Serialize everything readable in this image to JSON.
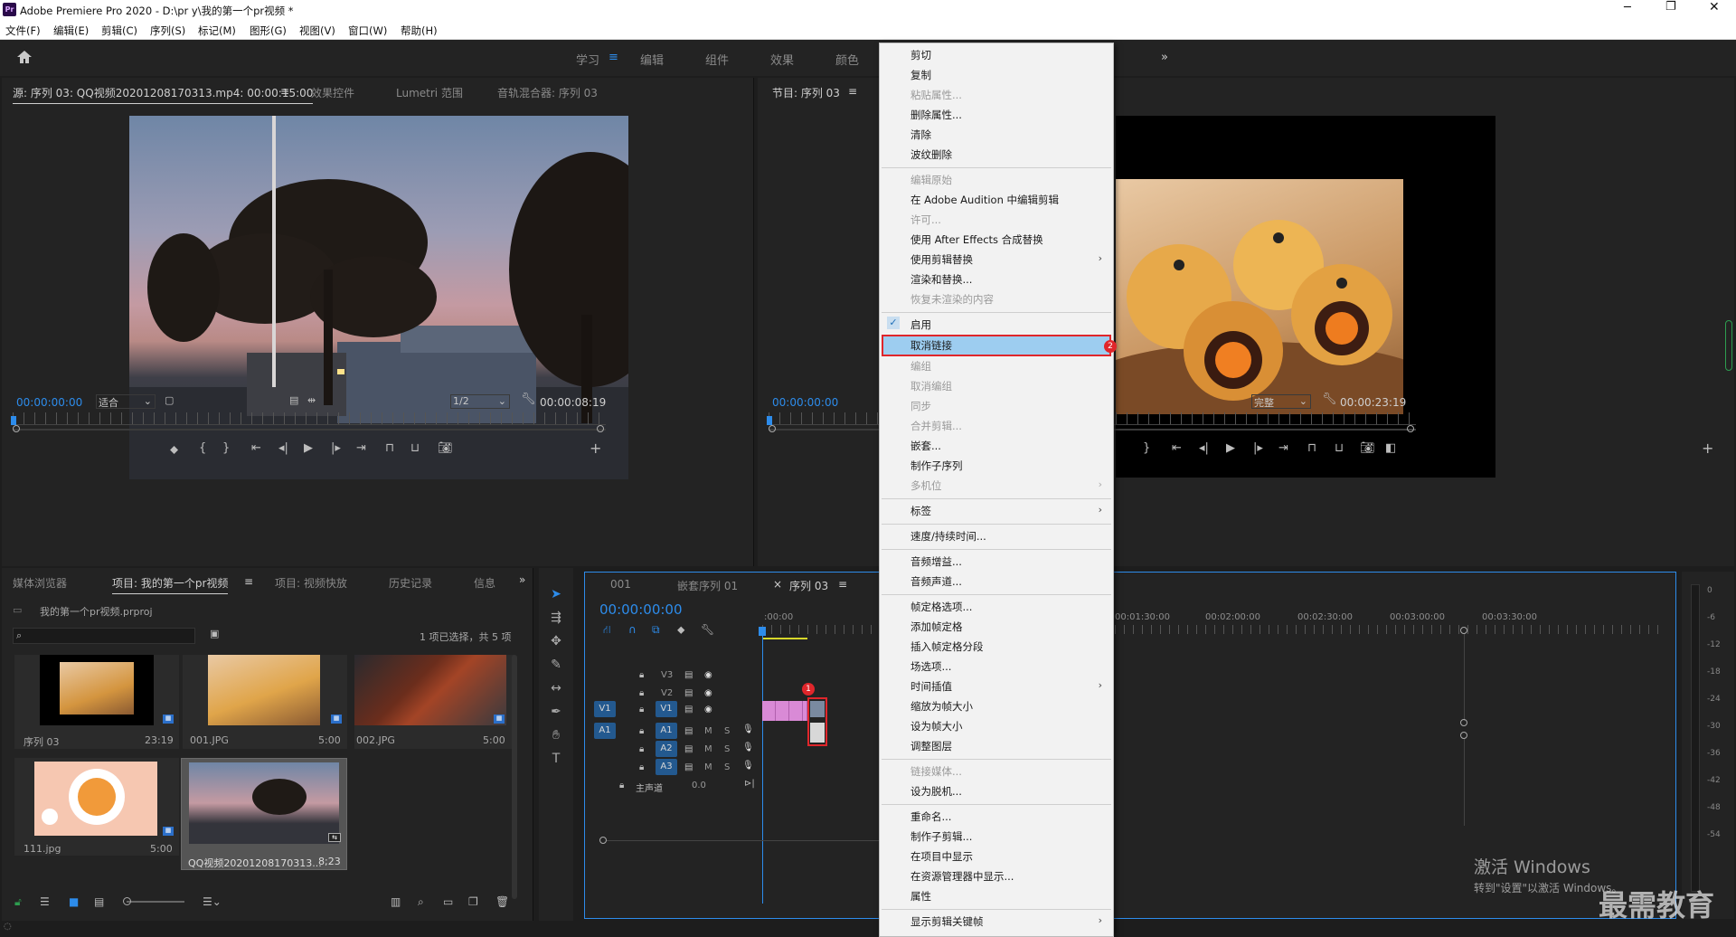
{
  "app": {
    "title": "Adobe Premiere Pro 2020 - D:\\pr y\\我的第一个pr视频 *",
    "logo": "Pr"
  },
  "menubar": [
    "文件(F)",
    "编辑(E)",
    "剪辑(C)",
    "序列(S)",
    "标记(M)",
    "图形(G)",
    "视图(V)",
    "窗口(W)",
    "帮助(H)"
  ],
  "workspaces": [
    "学习",
    "编辑",
    "组件",
    "效果",
    "颜色"
  ],
  "source_panel": {
    "tabs": [
      "源: 序列 03: QQ视频20201208170313.mp4: 00:00:15:00",
      "效果控件",
      "Lumetri 范围",
      "音轨混合器: 序列 03"
    ],
    "timecode_in": "00:00:00:00",
    "zoom": "适合",
    "resolution": "1/2",
    "timecode_dur": "00:00:08:19"
  },
  "program_panel": {
    "tab": "节目: 序列 03",
    "timecode_in": "00:00:00:00",
    "quality": "完整",
    "timecode_dur": "00:00:23:19"
  },
  "project_panel": {
    "tabs": [
      "媒体浏览器",
      "项目: 我的第一个pr视频",
      "项目: 视频快放",
      "历史记录",
      "信息"
    ],
    "project_file": "我的第一个pr视频.prproj",
    "selection_info": "1 项已选择，共 5 项",
    "items": [
      {
        "name": "序列 03",
        "dur": "23:19"
      },
      {
        "name": "001.JPG",
        "dur": "5:00"
      },
      {
        "name": "002.JPG",
        "dur": "5:00"
      },
      {
        "name": "111.jpg",
        "dur": "5:00"
      },
      {
        "name": "QQ视频20201208170313...",
        "dur": "8;23"
      }
    ]
  },
  "timeline": {
    "tabs": [
      "001",
      "嵌套序列 01",
      "序列 03"
    ],
    "timecode": "00:00:00:00",
    "ruler": [
      ":00:00",
      "00:01:30:00",
      "00:02:00:00",
      "00:02:30:00",
      "00:03:00:00",
      "00:03:30:00"
    ],
    "video_tracks": [
      "V3",
      "V2",
      "V1"
    ],
    "audio_tracks": [
      "A1",
      "A2",
      "A3"
    ],
    "source_v": "V1",
    "source_a": "A1",
    "master": "主声道",
    "master_val": "0.0",
    "mute": "M",
    "solo": "S"
  },
  "vu_scale": [
    "0",
    "-6",
    "-12",
    "-18",
    "-24",
    "-30",
    "-36",
    "-42",
    "-48",
    "-54"
  ],
  "context_menu": [
    {
      "label": "剪切",
      "state": "enabled"
    },
    {
      "label": "复制",
      "state": "enabled"
    },
    {
      "label": "粘贴属性...",
      "state": "disabled"
    },
    {
      "label": "删除属性...",
      "state": "enabled"
    },
    {
      "label": "清除",
      "state": "enabled"
    },
    {
      "label": "波纹删除",
      "state": "enabled"
    },
    {
      "label": "编辑原始",
      "state": "disabled"
    },
    {
      "label": "在 Adobe Audition 中编辑剪辑",
      "state": "enabled"
    },
    {
      "label": "许可...",
      "state": "disabled"
    },
    {
      "label": "使用 After Effects 合成替换",
      "state": "enabled"
    },
    {
      "label": "使用剪辑替换",
      "state": "enabled",
      "sub": true
    },
    {
      "label": "渲染和替换...",
      "state": "enabled"
    },
    {
      "label": "恢复未渲染的内容",
      "state": "disabled"
    },
    {
      "label": "启用",
      "state": "checked"
    },
    {
      "label": "取消链接",
      "state": "highlighted"
    },
    {
      "label": "编组",
      "state": "disabled"
    },
    {
      "label": "取消编组",
      "state": "disabled"
    },
    {
      "label": "同步",
      "state": "disabled"
    },
    {
      "label": "合并剪辑...",
      "state": "disabled"
    },
    {
      "label": "嵌套...",
      "state": "enabled"
    },
    {
      "label": "制作子序列",
      "state": "enabled"
    },
    {
      "label": "多机位",
      "state": "disabled",
      "sub": true
    },
    {
      "label": "标签",
      "state": "enabled",
      "sub": true
    },
    {
      "label": "速度/持续时间...",
      "state": "enabled"
    },
    {
      "label": "音频增益...",
      "state": "enabled"
    },
    {
      "label": "音频声道...",
      "state": "enabled"
    },
    {
      "label": "帧定格选项...",
      "state": "enabled"
    },
    {
      "label": "添加帧定格",
      "state": "enabled"
    },
    {
      "label": "插入帧定格分段",
      "state": "enabled"
    },
    {
      "label": "场选项...",
      "state": "enabled"
    },
    {
      "label": "时间插值",
      "state": "enabled",
      "sub": true
    },
    {
      "label": "缩放为帧大小",
      "state": "enabled"
    },
    {
      "label": "设为帧大小",
      "state": "enabled"
    },
    {
      "label": "调整图层",
      "state": "enabled"
    },
    {
      "label": "链接媒体...",
      "state": "disabled"
    },
    {
      "label": "设为脱机...",
      "state": "enabled"
    },
    {
      "label": "重命名...",
      "state": "enabled"
    },
    {
      "label": "制作子剪辑...",
      "state": "enabled"
    },
    {
      "label": "在项目中显示",
      "state": "enabled"
    },
    {
      "label": "在资源管理器中显示...",
      "state": "enabled"
    },
    {
      "label": "属性",
      "state": "enabled"
    },
    {
      "label": "显示剪辑关键帧",
      "state": "enabled",
      "sub": true
    }
  ],
  "markers": {
    "step1": "1",
    "step2": "2"
  },
  "watermark": {
    "line1": "激活 Windows",
    "line2": "转到\"设置\"以激活 Windows。",
    "brand": "最需教育"
  },
  "colors": {
    "accent": "#2d8ceb",
    "highlight_border": "#e0262b",
    "clip_pink": "#d98ad6",
    "menu_highlight": "#9dcdf0"
  }
}
